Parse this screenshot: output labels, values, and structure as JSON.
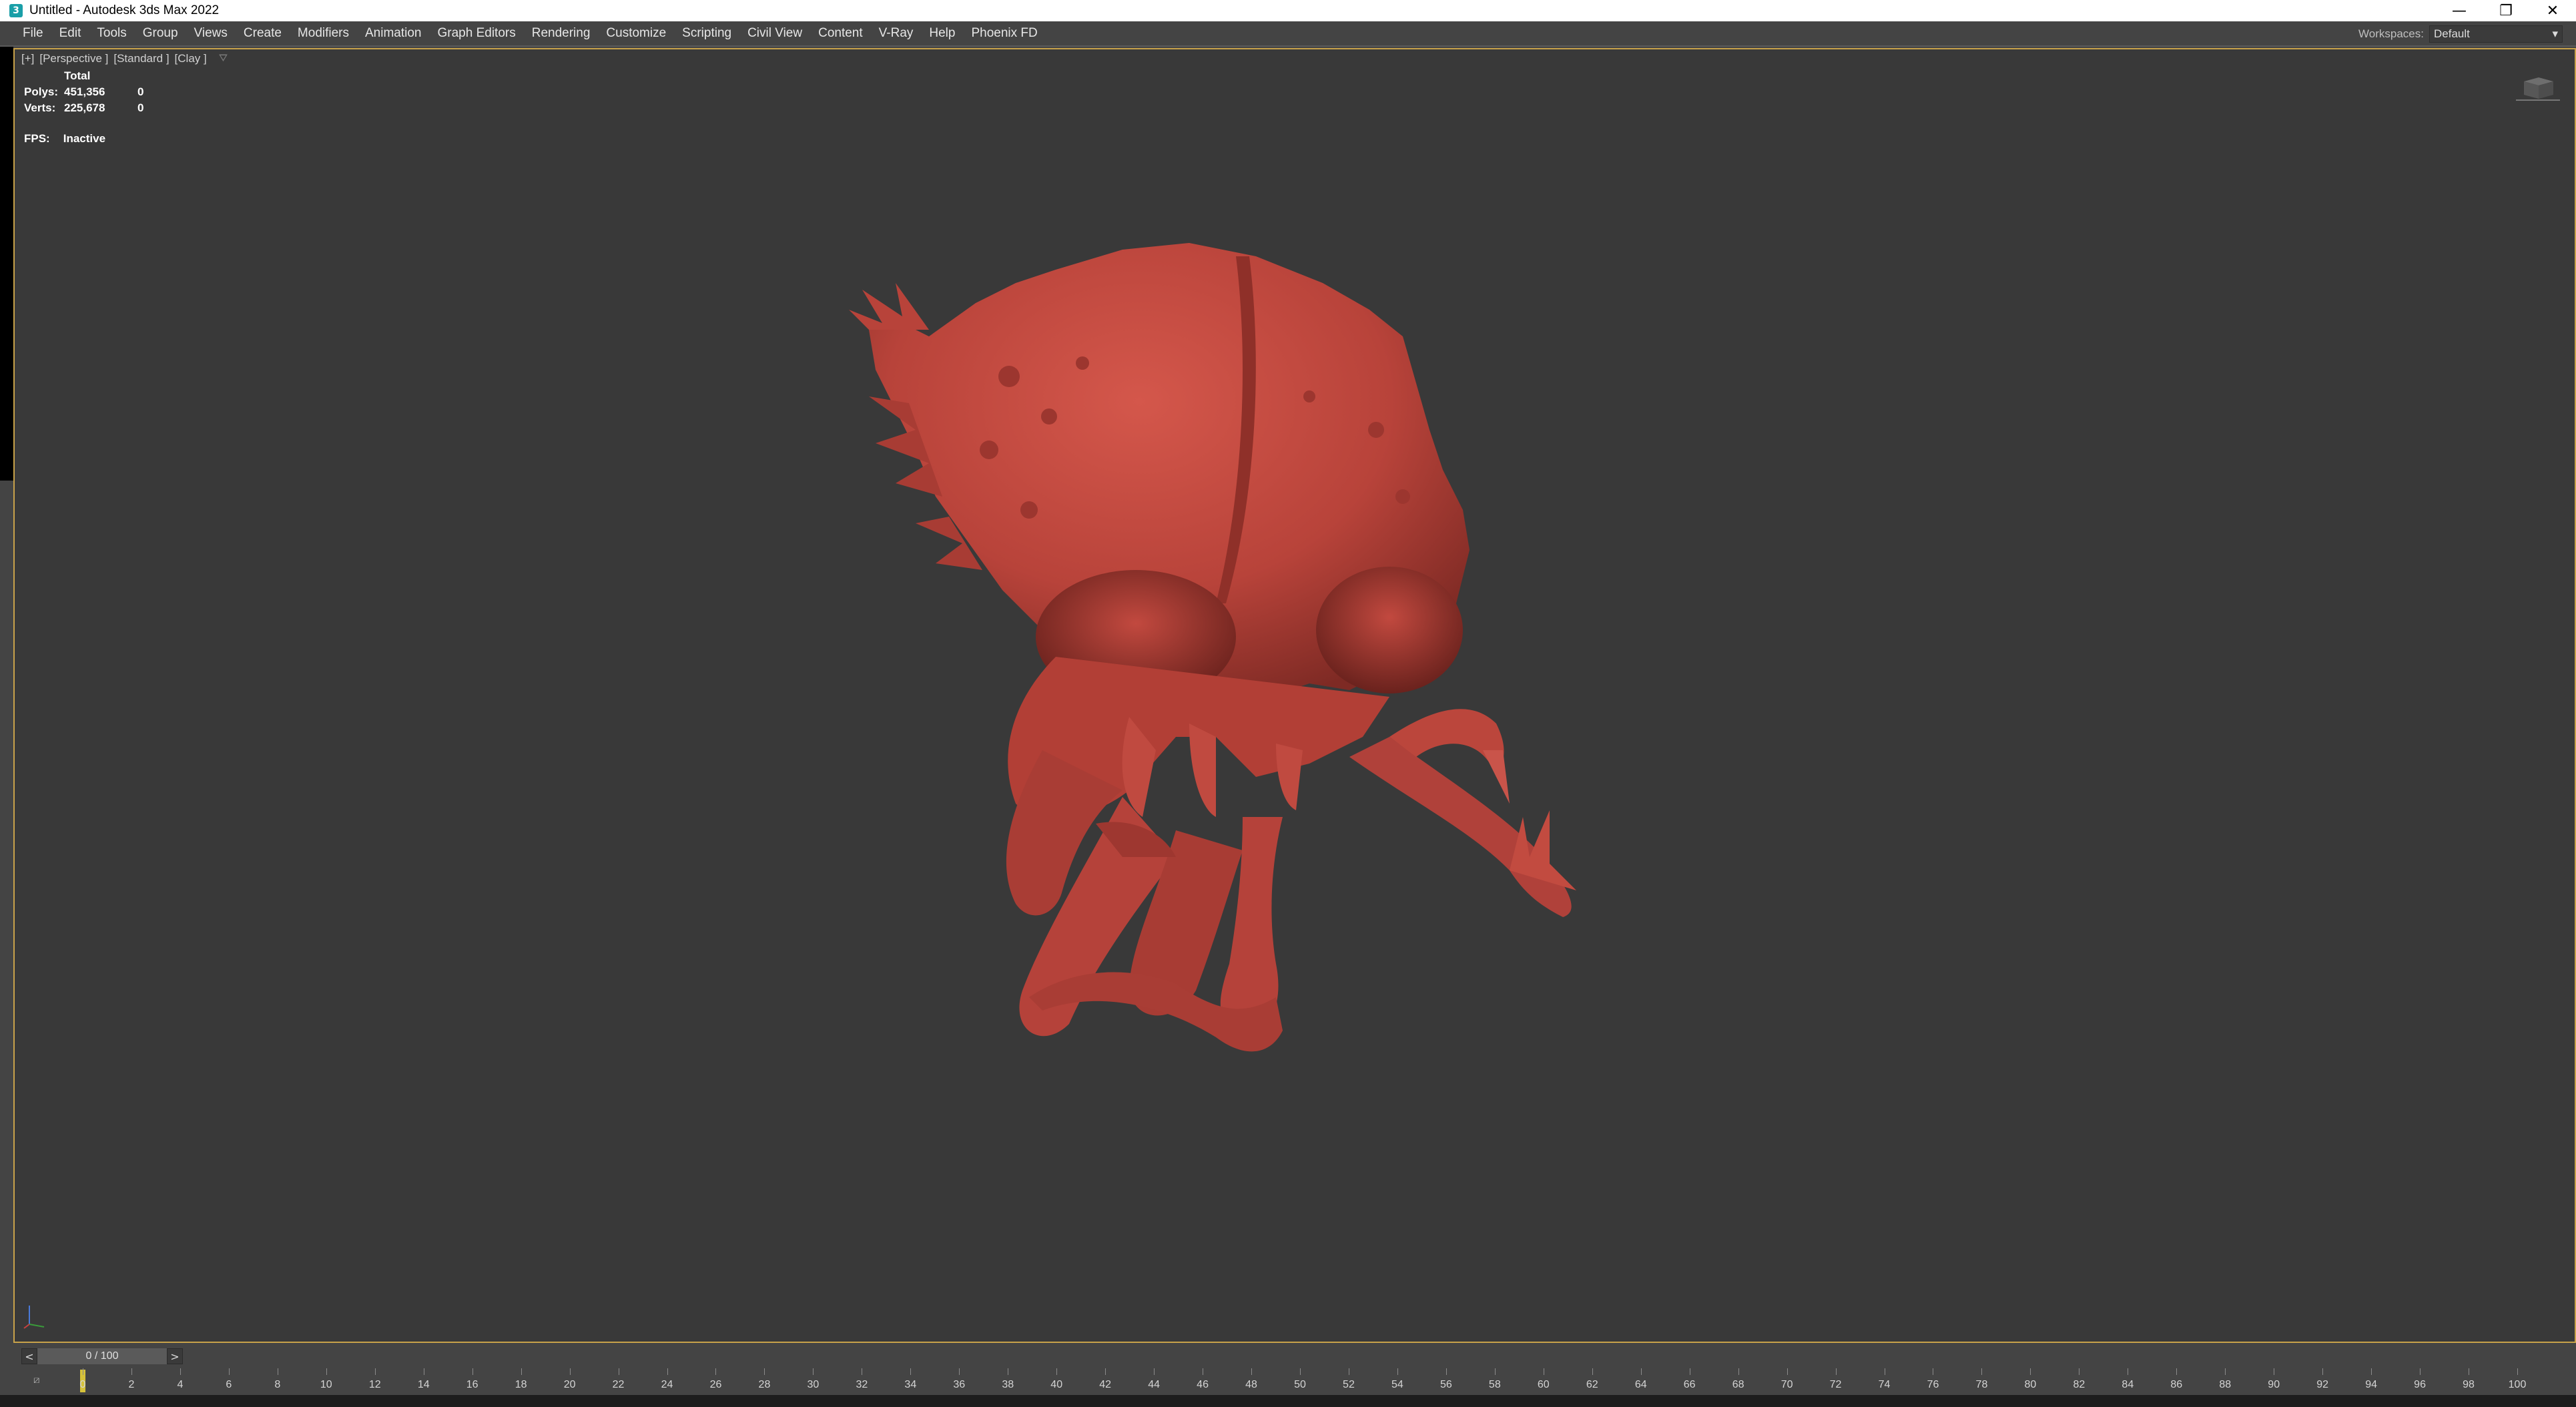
{
  "window": {
    "title": "Untitled - Autodesk 3ds Max 2022",
    "minimize": "—",
    "restore": "❐",
    "close": "✕"
  },
  "menu": {
    "items": [
      "File",
      "Edit",
      "Tools",
      "Group",
      "Views",
      "Create",
      "Modifiers",
      "Animation",
      "Graph Editors",
      "Rendering",
      "Customize",
      "Scripting",
      "Civil View",
      "Content",
      "V-Ray",
      "Help",
      "Phoenix FD"
    ],
    "workspaces_label": "Workspaces:",
    "workspace_value": "Default"
  },
  "viewport": {
    "label_plus": "[+]",
    "label_view": "[Perspective ]",
    "label_shading_std": "[Standard ]",
    "label_shading_clay": "[Clay ]",
    "stats": {
      "header": "Total",
      "polys_label": "Polys:",
      "polys_value": "451,356",
      "polys_sel": "0",
      "verts_label": "Verts:",
      "verts_value": "225,678",
      "verts_sel": "0"
    },
    "fps_label": "FPS:",
    "fps_value": "Inactive",
    "model_color": "#c0483e",
    "border_color": "#c8a24a"
  },
  "timeline": {
    "prev": "<",
    "next": ">",
    "frame_display": "0 / 100",
    "ticks": [
      "0",
      "2",
      "4",
      "6",
      "8",
      "10",
      "12",
      "14",
      "16",
      "18",
      "20",
      "22",
      "24",
      "26",
      "28",
      "30",
      "32",
      "34",
      "36",
      "38",
      "40",
      "42",
      "44",
      "46",
      "48",
      "50",
      "52",
      "54",
      "56",
      "58",
      "60",
      "62",
      "64",
      "66",
      "68",
      "70",
      "72",
      "74",
      "76",
      "78",
      "80",
      "82",
      "84",
      "86",
      "88",
      "90",
      "92",
      "94",
      "96",
      "98",
      "100"
    ]
  }
}
